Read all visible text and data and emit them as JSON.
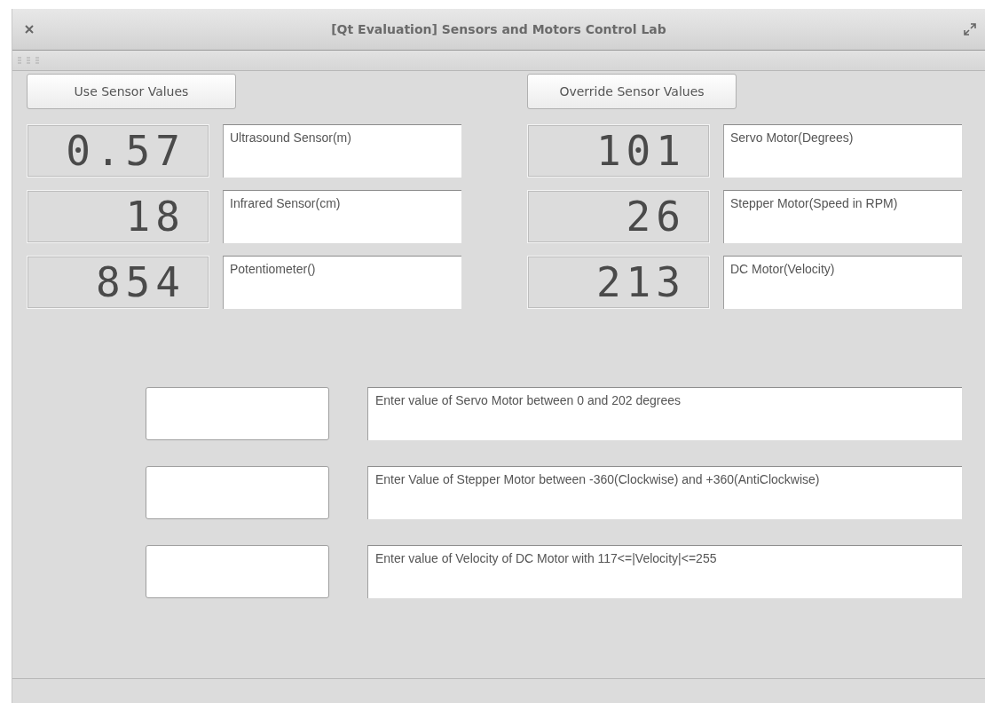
{
  "window": {
    "title": "[Qt Evaluation] Sensors and Motors Control Lab"
  },
  "buttons": [
    {
      "label": "Use Sensor Values"
    },
    {
      "label": "Override Sensor Values"
    }
  ],
  "sensors": [
    {
      "reading": "0.57",
      "label": "Ultrasound Sensor(m)"
    },
    {
      "reading": "18",
      "label": "Infrared Sensor(cm)"
    },
    {
      "reading": "854",
      "label": "Potentiometer()"
    }
  ],
  "motors": [
    {
      "reading": "101",
      "label": "Servo Motor(Degrees)"
    },
    {
      "reading": "26",
      "label": "Stepper Motor(Speed in RPM)"
    },
    {
      "reading": "213",
      "label": "DC Motor(Velocity)"
    }
  ],
  "inputs": [
    {
      "description": "Enter value of Servo Motor between 0 and 202 degrees"
    },
    {
      "description": "Enter Value of Stepper Motor between -360(Clockwise) and +360(AntiClockwise)"
    },
    {
      "description": "Enter value of Velocity of DC Motor with 117<=|Velocity|<=255"
    }
  ]
}
